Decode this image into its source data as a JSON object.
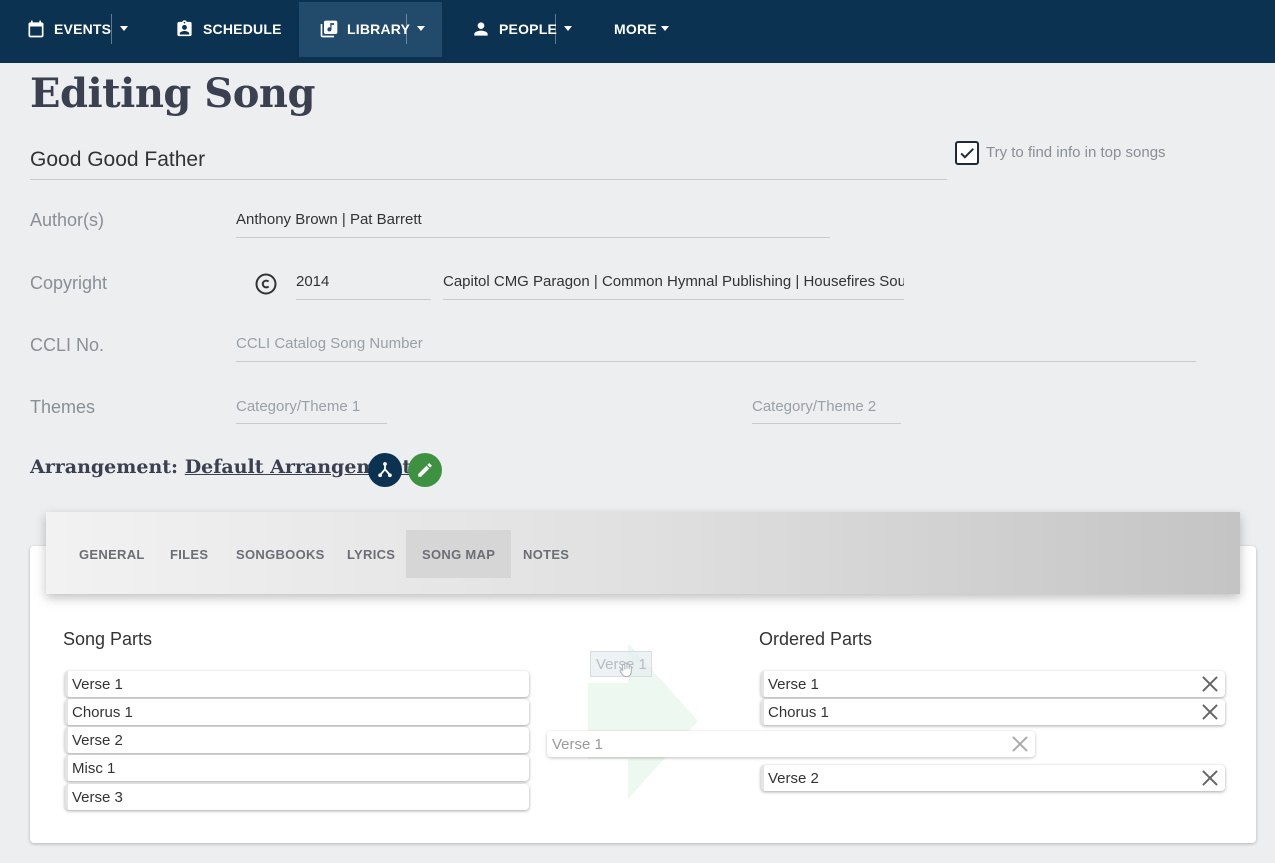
{
  "nav": {
    "events": "EVENTS",
    "schedule": "SCHEDULE",
    "library": "LIBRARY",
    "people": "PEOPLE",
    "more": "MORE"
  },
  "page": {
    "title": "Editing Song"
  },
  "song": {
    "title": "Good Good Father",
    "find_info_label": "Try to find info in top songs",
    "find_info_checked": true,
    "authors_label": "Author(s)",
    "authors_value": "Anthony Brown | Pat Barrett",
    "copyright_label": "Copyright",
    "copyright_year": "2014",
    "copyright_holders": "Capitol CMG Paragon | Common Hymnal Publishing | Housefires Sou",
    "ccli_label": "CCLI No.",
    "ccli_placeholder": "CCLI Catalog Song Number",
    "themes_label": "Themes",
    "theme1_placeholder": "Category/Theme 1",
    "theme2_placeholder": "Category/Theme 2"
  },
  "arrangement": {
    "prefix": "Arrangement:",
    "name": "Default Arrangement"
  },
  "tabs": [
    {
      "label": "GENERAL"
    },
    {
      "label": "FILES"
    },
    {
      "label": "SONGBOOKS"
    },
    {
      "label": "LYRICS"
    },
    {
      "label": "SONG MAP"
    },
    {
      "label": "NOTES"
    }
  ],
  "active_tab": "SONG MAP",
  "song_map": {
    "song_parts_heading": "Song Parts",
    "ordered_parts_heading": "Ordered Parts",
    "song_parts": [
      "Verse 1",
      "Chorus 1",
      "Verse 2",
      "Misc 1",
      "Verse 3"
    ],
    "ordered_parts": [
      "Verse 1",
      "Chorus 1",
      "Verse 2"
    ],
    "drag_chip": "Verse 1",
    "drop_placeholder": "Verse 1"
  },
  "colors": {
    "nav_bg": "#0c3252",
    "arrangement_button": "#0c3252",
    "edit_button": "#3d9140"
  }
}
